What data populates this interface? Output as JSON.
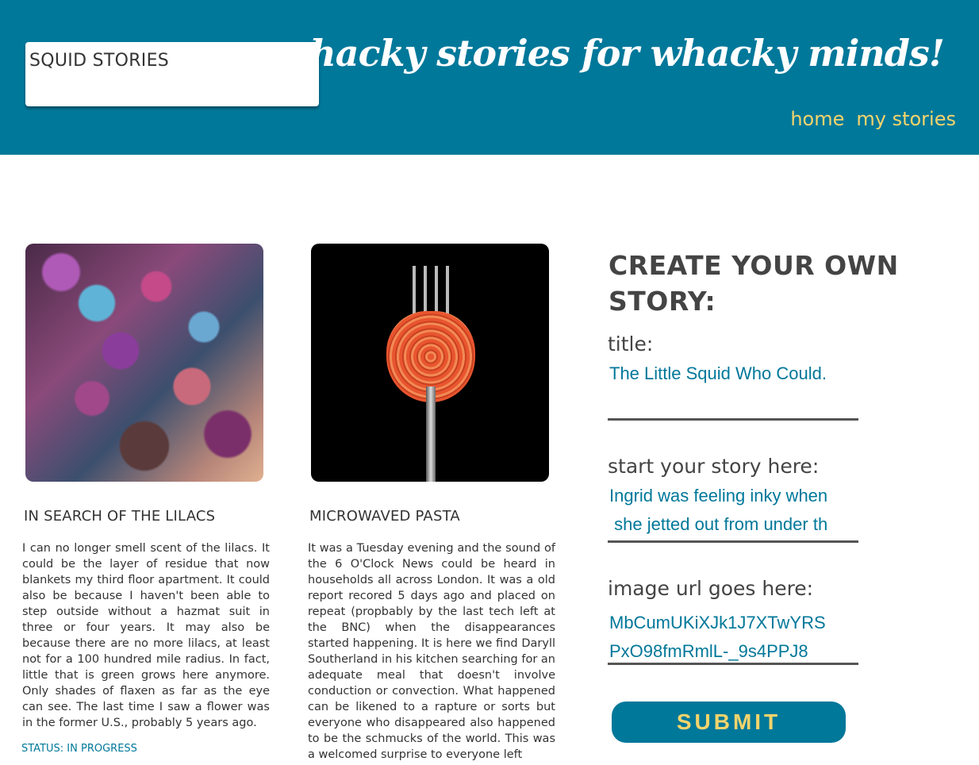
{
  "header": {
    "logo_text": "SQUID STORIES",
    "tagline": "whacky stories for whacky minds!",
    "nav": [
      {
        "label": "home"
      },
      {
        "label": "my stories"
      }
    ]
  },
  "cards": [
    {
      "image_icon": "lilacs-photo",
      "title": "IN SEARCH OF THE LILACS",
      "body": "I can no longer smell scent of the lilacs. It could be the layer of residue that now blankets my third floor apartment. It could also be because I haven't been able to step outside without a hazmat suit in three or four years. It may also be because there are no more lilacs, at least not for a 100 hundred mile radius. In fact, little that is green grows here anymore. Only shades of flaxen as far as the eye can see. The last time I saw a flower was in the former U.S., probably 5 years ago.",
      "status": "STATUS: IN PROGRESS"
    },
    {
      "image_icon": "pasta-fork-photo",
      "title": "MICROWAVED PASTA",
      "body": "It was a Tuesday evening and the sound of the 6 O'Clock News could be heard in households all across London. It was a old report recored 5 days ago and placed on repeat (propbably by the last tech left at the BNC) when the disappearances started happening. It is here we find Daryll Southerland in his kitchen searching for an adequate meal that doesn't involve conduction or convection. What happened can be likened to a rapture or sorts but everyone who disappeared also happened to be the schmucks of the world. This was a welcomed surprise to everyone left"
    }
  ],
  "form": {
    "heading": "CREATE YOUR OWN STORY:",
    "title_label": "title:",
    "title_value": "The Little Squid Who Could.",
    "story_label": "start your story here:",
    "story_value": "Ingrid was feeling inky when\n she jetted out from under th",
    "image_label": "image url goes here:",
    "image_value": "MbCumUKiXJk1J7XTwYRS\nPxO98fmRmlL-_9s4PPJ8",
    "submit_label": "SUBMIT"
  },
  "colors": {
    "brand": "#00789a",
    "accent": "#f5d46b"
  }
}
